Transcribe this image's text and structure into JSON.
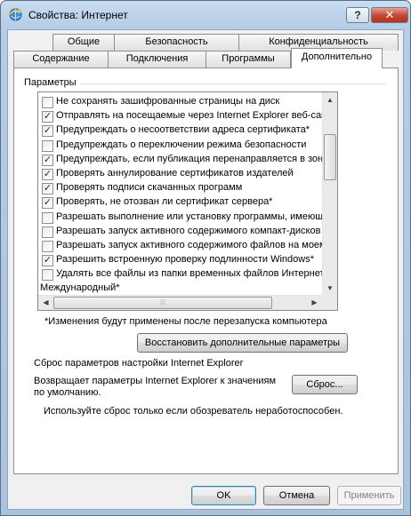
{
  "window": {
    "title": "Свойства: Интернет",
    "help": "?",
    "close": "✕"
  },
  "tabs_back": [
    {
      "label": "Общие"
    },
    {
      "label": "Безопасность"
    },
    {
      "label": "Конфиденциальность"
    }
  ],
  "tabs_front": [
    {
      "label": "Содержание"
    },
    {
      "label": "Подключения"
    },
    {
      "label": "Программы"
    },
    {
      "label": "Дополнительно"
    }
  ],
  "settings": {
    "group_label": "Параметры",
    "items": [
      {
        "label": "Не сохранять зашифрованные страницы на диск",
        "checked": false
      },
      {
        "label": "Отправлять на посещаемые через Internet Explorer веб-сайты запросы",
        "checked": true
      },
      {
        "label": "Предупреждать о несоответствии адреса сертификата*",
        "checked": true
      },
      {
        "label": "Предупреждать о переключении режима безопасности",
        "checked": false
      },
      {
        "label": "Предупреждать, если публикация перенаправляется в зону",
        "checked": true
      },
      {
        "label": "Проверять аннулирование сертификатов издателей",
        "checked": true
      },
      {
        "label": "Проверять подписи скачанных программ",
        "checked": true
      },
      {
        "label": "Проверять, не отозван ли сертификат сервера*",
        "checked": true
      },
      {
        "label": "Разрешать выполнение или установку программы, имеющей",
        "checked": false
      },
      {
        "label": "Разрешать запуск активного содержимого компакт-дисков",
        "checked": false
      },
      {
        "label": "Разрешать запуск активного содержимого файлов на моем",
        "checked": false
      },
      {
        "label": "Разрешить встроенную проверку подлинности Windows*",
        "checked": true
      },
      {
        "label": "Удалять все файлы из папки временных файлов Интернета",
        "checked": false
      }
    ],
    "subheading": "Международный*",
    "restart_note": "*Изменения будут применены после перезапуска компьютера",
    "restore_button": "Восстановить дополнительные параметры"
  },
  "reset": {
    "group_label": "Сброс параметров настройки Internet Explorer",
    "description_line1": "Возвращает параметры Internet Explorer к значениям",
    "description_line2": "по умолчанию.",
    "reset_button": "Сброс...",
    "hint": "Используйте сброс только если обозреватель неработоспособен."
  },
  "buttons": {
    "ok": "OK",
    "cancel": "Отмена",
    "apply": "Применить"
  },
  "icons": {
    "title": "ie-globe-icon",
    "check": "✓",
    "arrow_up": "▲",
    "arrow_down": "▼",
    "arrow_left": "◀",
    "arrow_right": "▶",
    "grip": "⦙⦙⦙"
  }
}
